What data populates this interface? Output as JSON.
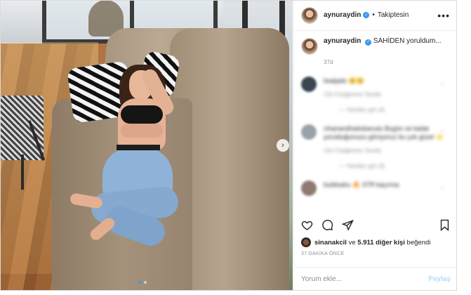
{
  "header": {
    "username": "aynuraydin",
    "verified": true,
    "follow_separator": "•",
    "follow_state": "Takiptesin",
    "more_icon": "more-horizontal-icon"
  },
  "caption": {
    "username": "aynuraydin",
    "text": "SAHİDEN yoruldum...",
    "time": "37d"
  },
  "comments": [
    {
      "user": "lisatjado",
      "text": "😊😊",
      "meta": "13s 6 beğenme Yanıtla",
      "replies": "— Yanıtları gör (4)"
    },
    {
      "user": "cihanandhadubarudu",
      "text": "Bugün ne kadar yorulduğumuzu görüyoruz bu çok güzel ⭐",
      "meta": "13s 5 beğenme Yanıtla",
      "replies": "— Yanıtları gör (3)"
    },
    {
      "user": "buldisahu",
      "text": "🔥 STR kaçırma"
    }
  ],
  "actions": {
    "like_icon": "heart-icon",
    "comment_icon": "comment-icon",
    "share_icon": "share-icon",
    "save_icon": "bookmark-icon"
  },
  "likes": {
    "user": "sinanakcil",
    "connector": "ve",
    "others": "5.911 diğer kişi",
    "suffix": "beğendi"
  },
  "timestamp": "37 DAKİKA ÖNCE",
  "add_comment": {
    "placeholder": "Yorum ekle...",
    "post_label": "Paylaş"
  },
  "carousel": {
    "current": 1,
    "total": 2,
    "next_icon": "chevron-right-icon"
  },
  "colors": {
    "accent": "#3897f0",
    "post_disabled": "#b2dffc",
    "muted": "#8e8e8e"
  }
}
